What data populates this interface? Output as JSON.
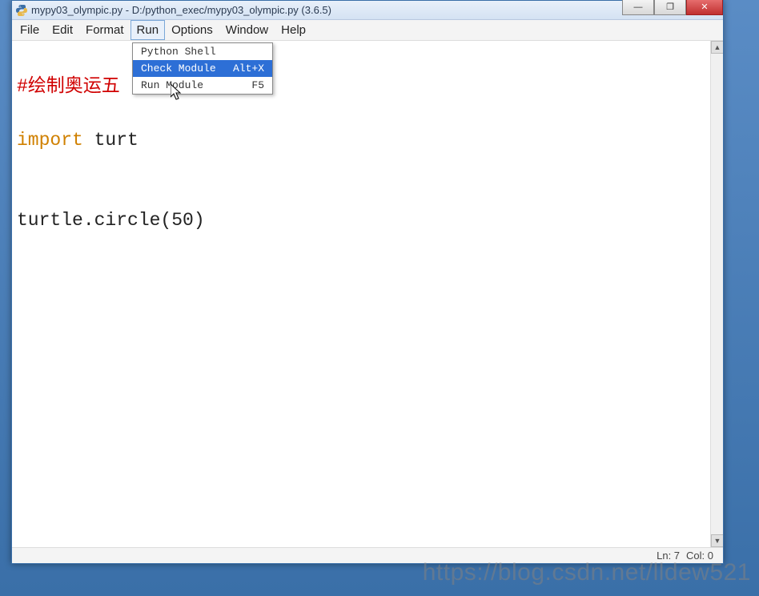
{
  "window": {
    "title": "mypy03_olympic.py - D:/python_exec/mypy03_olympic.py (3.6.5)"
  },
  "menubar": {
    "items": [
      "File",
      "Edit",
      "Format",
      "Run",
      "Options",
      "Window",
      "Help"
    ],
    "active_index": 3
  },
  "dropdown": {
    "items": [
      {
        "label": "Python Shell",
        "shortcut": ""
      },
      {
        "label": "Check Module",
        "shortcut": "Alt+X"
      },
      {
        "label": "Run Module",
        "shortcut": "F5"
      }
    ],
    "highlighted_index": 1
  },
  "code": {
    "line1_comment": "#绘制奥运五",
    "line2_import_kw": "import",
    "line2_rest": " turt",
    "line3": "turtle.circle(50)"
  },
  "statusbar": {
    "line_label": "Ln: 7",
    "col_label": "Col: 0"
  },
  "win_controls": {
    "minimize": "—",
    "maximize": "❐",
    "close": "✕"
  },
  "watermark": "https://blog.csdn.net/lldew521"
}
